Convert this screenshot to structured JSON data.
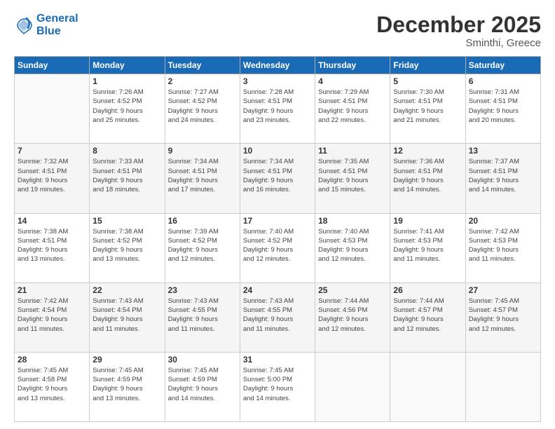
{
  "logo": {
    "line1": "General",
    "line2": "Blue"
  },
  "header": {
    "month_year": "December 2025",
    "location": "Sminthi, Greece"
  },
  "weekdays": [
    "Sunday",
    "Monday",
    "Tuesday",
    "Wednesday",
    "Thursday",
    "Friday",
    "Saturday"
  ],
  "weeks": [
    [
      {
        "day": "",
        "info": ""
      },
      {
        "day": "1",
        "info": "Sunrise: 7:26 AM\nSunset: 4:52 PM\nDaylight: 9 hours\nand 25 minutes."
      },
      {
        "day": "2",
        "info": "Sunrise: 7:27 AM\nSunset: 4:52 PM\nDaylight: 9 hours\nand 24 minutes."
      },
      {
        "day": "3",
        "info": "Sunrise: 7:28 AM\nSunset: 4:51 PM\nDaylight: 9 hours\nand 23 minutes."
      },
      {
        "day": "4",
        "info": "Sunrise: 7:29 AM\nSunset: 4:51 PM\nDaylight: 9 hours\nand 22 minutes."
      },
      {
        "day": "5",
        "info": "Sunrise: 7:30 AM\nSunset: 4:51 PM\nDaylight: 9 hours\nand 21 minutes."
      },
      {
        "day": "6",
        "info": "Sunrise: 7:31 AM\nSunset: 4:51 PM\nDaylight: 9 hours\nand 20 minutes."
      }
    ],
    [
      {
        "day": "7",
        "info": "Sunrise: 7:32 AM\nSunset: 4:51 PM\nDaylight: 9 hours\nand 19 minutes."
      },
      {
        "day": "8",
        "info": "Sunrise: 7:33 AM\nSunset: 4:51 PM\nDaylight: 9 hours\nand 18 minutes."
      },
      {
        "day": "9",
        "info": "Sunrise: 7:34 AM\nSunset: 4:51 PM\nDaylight: 9 hours\nand 17 minutes."
      },
      {
        "day": "10",
        "info": "Sunrise: 7:34 AM\nSunset: 4:51 PM\nDaylight: 9 hours\nand 16 minutes."
      },
      {
        "day": "11",
        "info": "Sunrise: 7:35 AM\nSunset: 4:51 PM\nDaylight: 9 hours\nand 15 minutes."
      },
      {
        "day": "12",
        "info": "Sunrise: 7:36 AM\nSunset: 4:51 PM\nDaylight: 9 hours\nand 14 minutes."
      },
      {
        "day": "13",
        "info": "Sunrise: 7:37 AM\nSunset: 4:51 PM\nDaylight: 9 hours\nand 14 minutes."
      }
    ],
    [
      {
        "day": "14",
        "info": "Sunrise: 7:38 AM\nSunset: 4:51 PM\nDaylight: 9 hours\nand 13 minutes."
      },
      {
        "day": "15",
        "info": "Sunrise: 7:38 AM\nSunset: 4:52 PM\nDaylight: 9 hours\nand 13 minutes."
      },
      {
        "day": "16",
        "info": "Sunrise: 7:39 AM\nSunset: 4:52 PM\nDaylight: 9 hours\nand 12 minutes."
      },
      {
        "day": "17",
        "info": "Sunrise: 7:40 AM\nSunset: 4:52 PM\nDaylight: 9 hours\nand 12 minutes."
      },
      {
        "day": "18",
        "info": "Sunrise: 7:40 AM\nSunset: 4:53 PM\nDaylight: 9 hours\nand 12 minutes."
      },
      {
        "day": "19",
        "info": "Sunrise: 7:41 AM\nSunset: 4:53 PM\nDaylight: 9 hours\nand 11 minutes."
      },
      {
        "day": "20",
        "info": "Sunrise: 7:42 AM\nSunset: 4:53 PM\nDaylight: 9 hours\nand 11 minutes."
      }
    ],
    [
      {
        "day": "21",
        "info": "Sunrise: 7:42 AM\nSunset: 4:54 PM\nDaylight: 9 hours\nand 11 minutes."
      },
      {
        "day": "22",
        "info": "Sunrise: 7:43 AM\nSunset: 4:54 PM\nDaylight: 9 hours\nand 11 minutes."
      },
      {
        "day": "23",
        "info": "Sunrise: 7:43 AM\nSunset: 4:55 PM\nDaylight: 9 hours\nand 11 minutes."
      },
      {
        "day": "24",
        "info": "Sunrise: 7:43 AM\nSunset: 4:55 PM\nDaylight: 9 hours\nand 11 minutes."
      },
      {
        "day": "25",
        "info": "Sunrise: 7:44 AM\nSunset: 4:56 PM\nDaylight: 9 hours\nand 12 minutes."
      },
      {
        "day": "26",
        "info": "Sunrise: 7:44 AM\nSunset: 4:57 PM\nDaylight: 9 hours\nand 12 minutes."
      },
      {
        "day": "27",
        "info": "Sunrise: 7:45 AM\nSunset: 4:57 PM\nDaylight: 9 hours\nand 12 minutes."
      }
    ],
    [
      {
        "day": "28",
        "info": "Sunrise: 7:45 AM\nSunset: 4:58 PM\nDaylight: 9 hours\nand 13 minutes."
      },
      {
        "day": "29",
        "info": "Sunrise: 7:45 AM\nSunset: 4:59 PM\nDaylight: 9 hours\nand 13 minutes."
      },
      {
        "day": "30",
        "info": "Sunrise: 7:45 AM\nSunset: 4:59 PM\nDaylight: 9 hours\nand 14 minutes."
      },
      {
        "day": "31",
        "info": "Sunrise: 7:45 AM\nSunset: 5:00 PM\nDaylight: 9 hours\nand 14 minutes."
      },
      {
        "day": "",
        "info": ""
      },
      {
        "day": "",
        "info": ""
      },
      {
        "day": "",
        "info": ""
      }
    ]
  ]
}
